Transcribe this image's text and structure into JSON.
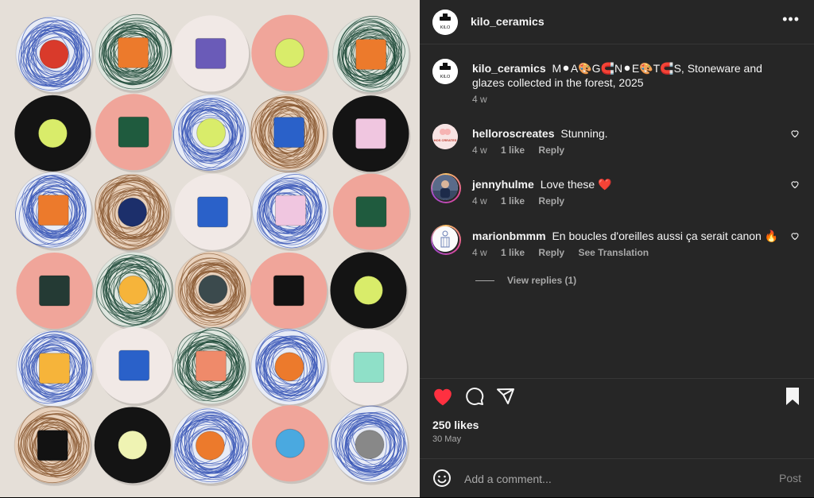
{
  "post_header": {
    "username": "kilo_ceramics",
    "more_icon": "more-horizontal-icon"
  },
  "caption": {
    "username": "kilo_ceramics",
    "text": "M⚫A🎨G🧲N⚫E🎨T🧲S, Stoneware and glazes collected in the forest, 2025",
    "time": "4 w"
  },
  "comments": [
    {
      "username": "helloroscreates",
      "text": "Stunning.",
      "time": "4 w",
      "likes": "1 like",
      "reply": "Reply"
    },
    {
      "username": "jennyhulme",
      "text": "Love these ❤️",
      "time": "4 w",
      "likes": "1 like",
      "reply": "Reply"
    },
    {
      "username": "marionbmmm",
      "text": "En boucles d'oreilles aussi ça serait canon 🔥",
      "time": "4 w",
      "likes": "1 like",
      "reply": "Reply",
      "translate": "See Translation"
    }
  ],
  "view_replies": "View replies (1)",
  "actions": {
    "likes": "250 likes",
    "date": "30 May",
    "liked": true
  },
  "add_comment": {
    "placeholder": "Add a comment...",
    "post_label": "Post"
  },
  "avatar_text": {
    "kilo": "KILO",
    "hello": "HOS CREATES"
  },
  "colors": {
    "bg": "#262626",
    "text": "#f5f5f5",
    "secondary": "#a8a8a8",
    "like_red": "#ff3040"
  },
  "photo": {
    "description_grid": [
      [
        "blue-red-dot",
        "green-orange-square",
        "white-purple-square",
        "pink-lime-dot",
        "green-orange-square"
      ],
      [
        "black-lime-dot",
        "pink-green-square",
        "blue-lime-dot",
        "brown-blue-square",
        "black-pink-square"
      ],
      [
        "blue-orange-square",
        "brown-navy-dot",
        "white-blue-square",
        "blue-pink-square",
        "pink-green-square"
      ],
      [
        "pink-darkgreen-square",
        "green-yellow-dot",
        "brown-slate-dot",
        "pink-black-square",
        "black-lime-dot"
      ],
      [
        "blue-yellow-square",
        "white-blue-square",
        "green-salmon-square",
        "blue-orange-dot",
        "white-mint-square"
      ],
      [
        "brown-black-square",
        "black-cream-dot",
        "blue-orange-dot",
        "pink-skyblue-dot",
        "blue-brown-dot"
      ]
    ]
  }
}
